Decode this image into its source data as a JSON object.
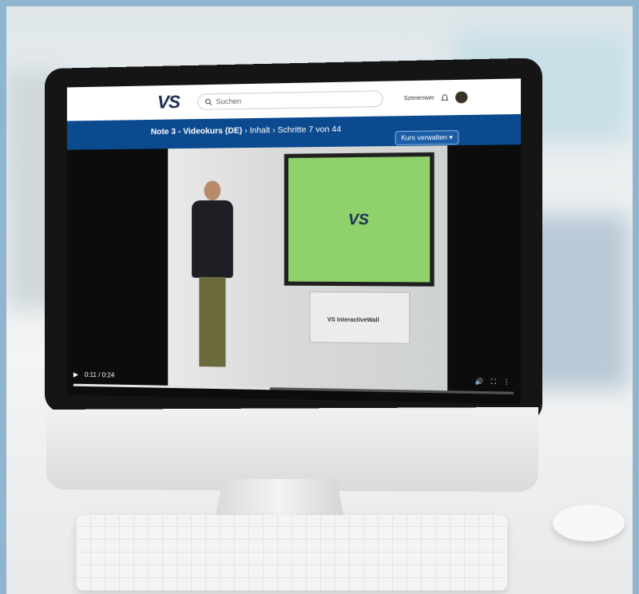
{
  "site": {
    "logo": "VS",
    "search_placeholder": "Suchen",
    "user_label": "Szenenwer"
  },
  "breadcrumb": {
    "course": "Note 3 - Videokurs (DE)",
    "sep1": "›",
    "section": "Inhalt",
    "sep2": "›",
    "step": "Schritte 7 von 44"
  },
  "buttons": {
    "manage_course": "Kurs verwalten ▾"
  },
  "video": {
    "board_logo": "VS",
    "cart_label": "VS InteractiveWall",
    "time": "0:11 / 0:24",
    "progress": 0.46,
    "play_glyph": "▶",
    "volume_glyph": "🔊",
    "fullscreen_glyph": "⛶",
    "menu_glyph": "⋮"
  },
  "colors": {
    "navy": "#1c2d52",
    "accent": "#e05a1e",
    "bluebar": "#0b4a8f",
    "green_screen": "#8fd16b"
  }
}
